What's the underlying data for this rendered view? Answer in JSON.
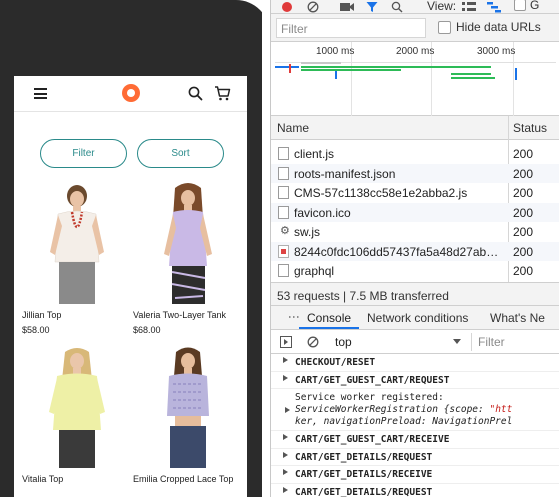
{
  "store": {
    "filter_label": "Filter",
    "sort_label": "Sort",
    "products": [
      {
        "name": "Jillian Top",
        "price": "$58.00"
      },
      {
        "name": "Valeria Two-Layer Tank",
        "price": "$68.00"
      },
      {
        "name": "Vitalia Top",
        "price": ""
      },
      {
        "name": "Emilia Cropped Lace Top",
        "price": ""
      }
    ]
  },
  "devtools": {
    "toolbar": {
      "view_label": "View:"
    },
    "filter": {
      "placeholder": "Filter",
      "hide_data_urls_label": "Hide data URLs"
    },
    "timeline": {
      "ticks": [
        "1000 ms",
        "2000 ms",
        "3000 ms"
      ]
    },
    "table": {
      "columns": [
        "Name",
        "Status"
      ],
      "rows": [
        {
          "name": "client.js",
          "status": "200",
          "icon": "file-icon"
        },
        {
          "name": "roots-manifest.json",
          "status": "200",
          "icon": "file-icon"
        },
        {
          "name": "CMS-57c1138cc58e1e2abba2.js",
          "status": "200",
          "icon": "file-icon"
        },
        {
          "name": "favicon.ico",
          "status": "200",
          "icon": "file-icon"
        },
        {
          "name": "sw.js",
          "status": "200",
          "icon": "gear-icon"
        },
        {
          "name": "8244c0fdc106dd57437fa5a48d27ab0d....",
          "status": "200",
          "icon": "image-icon"
        },
        {
          "name": "graphql",
          "status": "200",
          "icon": "file-icon"
        }
      ]
    },
    "summary": "53 requests | 7.5 MB transferred",
    "drawer_tabs": [
      "Console",
      "Network conditions",
      "What's Ne"
    ],
    "console_context": "top",
    "console_filter_placeholder": "Filter",
    "console_lines": [
      "CHECKOUT/RESET",
      "CART/GET_GUEST_CART/REQUEST",
      "CART/GET_GUEST_CART/RECEIVE",
      "CART/GET_DETAILS/REQUEST",
      "CART/GET_DETAILS/RECEIVE",
      "CART/GET_DETAILS/REQUEST"
    ],
    "sw_message": {
      "line1": "Service worker registered:",
      "line2_obj": "ServiceWorkerRegistration {scope: ",
      "line2_str": "\"htt",
      "line3": "ker, navigationPreload: NavigationPrel"
    }
  },
  "colors": {
    "accent": "#2a8a8a",
    "logo": "#ff6b35",
    "tab_active": "#1a73e8"
  }
}
